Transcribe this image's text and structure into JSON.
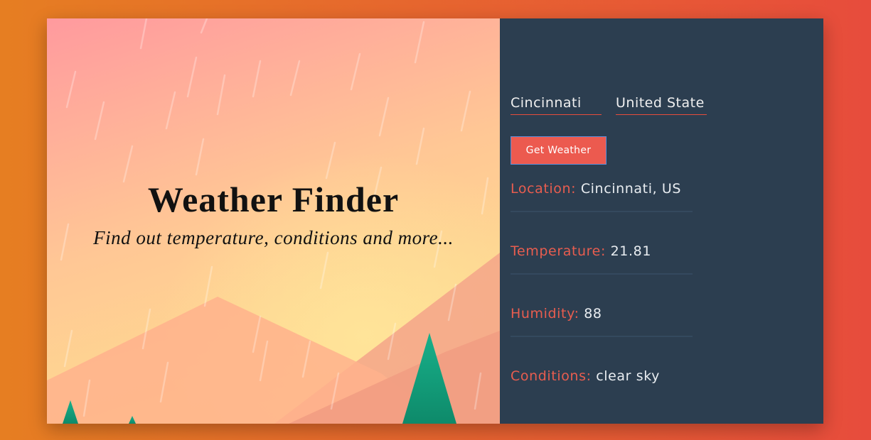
{
  "hero": {
    "title": "Weather Finder",
    "subtitle": "Find out temperature, conditions and more..."
  },
  "form": {
    "city_value": "Cincinnati",
    "country_value": "United State",
    "button_label": "Get Weather"
  },
  "results": [
    {
      "label": "Location:",
      "value": "Cincinnati, US"
    },
    {
      "label": "Temperature:",
      "value": "21.81"
    },
    {
      "label": "Humidity:",
      "value": "88"
    },
    {
      "label": "Conditions:",
      "value": "clear sky"
    }
  ],
  "colors": {
    "page_gradient_start": "#e67e22",
    "page_gradient_end": "#e74c3c",
    "right_panel_bg": "#2c3e50",
    "accent": "#e74c3c",
    "button_bg": "#ec5a4f",
    "tree": "#16a085"
  }
}
